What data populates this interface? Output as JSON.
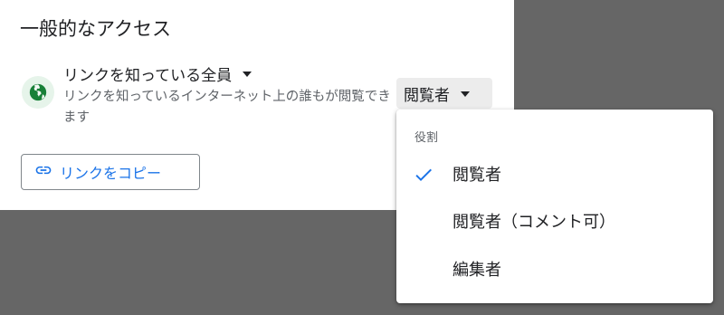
{
  "general_access": {
    "title": "一般的なアクセス",
    "scope_label": "リンクを知っている全員",
    "description": "リンクを知っているインターネット上の誰もが閲覧できます",
    "role_selected": "閲覧者",
    "copy_link_label": "リンクをコピー"
  },
  "role_menu": {
    "header": "役割",
    "items": [
      {
        "label": "閲覧者",
        "checked": true
      },
      {
        "label": "閲覧者（コメント可）",
        "checked": false
      },
      {
        "label": "編集者",
        "checked": false
      }
    ]
  },
  "icons": {
    "globe": "globe-icon",
    "link": "link-icon",
    "check": "check-icon",
    "caret": "caret-down-icon"
  },
  "colors": {
    "overlay": "#666666",
    "accent_blue": "#1a73e8",
    "globe_green": "#188038",
    "globe_bg": "#e6f4ea"
  }
}
